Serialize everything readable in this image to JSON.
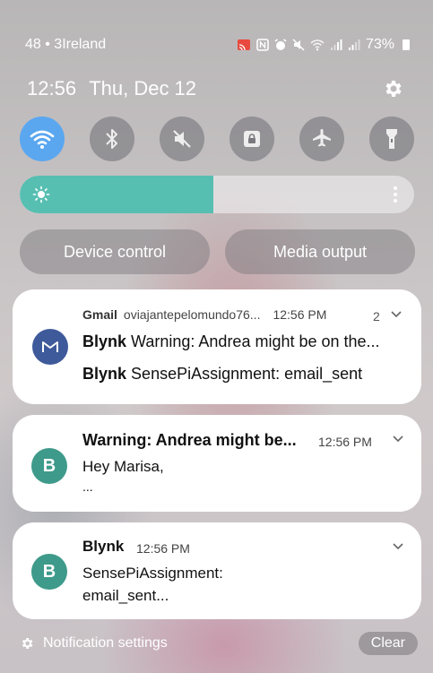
{
  "status_bar": {
    "carrier": "48 • 3Ireland",
    "battery": "73%",
    "icons": [
      "cast-icon",
      "nfc-icon",
      "alarm-icon",
      "mute-icon",
      "wifi-icon",
      "signal-icon",
      "signal-icon",
      "battery-icon"
    ]
  },
  "header": {
    "time": "12:56",
    "date": "Thu, Dec 12"
  },
  "quick_toggles": [
    {
      "name": "wifi",
      "icon": "wifi-icon",
      "active": true
    },
    {
      "name": "bluetooth",
      "icon": "bluetooth-icon",
      "active": false
    },
    {
      "name": "sound",
      "icon": "mute-icon",
      "active": false
    },
    {
      "name": "rotation-lock",
      "icon": "lock-icon",
      "active": false
    },
    {
      "name": "airplane-mode",
      "icon": "airplane-icon",
      "active": false
    },
    {
      "name": "flashlight",
      "icon": "flashlight-icon",
      "active": false
    }
  ],
  "brightness": {
    "level": 0.49
  },
  "buttons": {
    "device_control": "Device control",
    "media_output": "Media output"
  },
  "notifications": [
    {
      "app": "Gmail",
      "account": "oviajantepelomundo76...",
      "time": "12:56 PM",
      "count": "2",
      "lines": [
        {
          "sender": "Blynk",
          "text": "Warning: Andrea might be on the..."
        },
        {
          "sender": "Blynk",
          "text": "SensePiAssignment: email_sent"
        }
      ],
      "avatar_color": "#3f5a9a"
    },
    {
      "title": "Warning: Andrea might be...",
      "time": "12:56 PM",
      "body_line1": "Hey Marisa,",
      "body_line2": "...",
      "avatar_letter": "B",
      "avatar_color": "#3e9a8a"
    },
    {
      "title": "Blynk",
      "time": "12:56 PM",
      "body_line1": "SensePiAssignment:",
      "body_line2": "email_sent...",
      "avatar_letter": "B",
      "avatar_color": "#3e9a8a"
    }
  ],
  "footer": {
    "settings_label": "Notification settings",
    "clear_label": "Clear"
  }
}
